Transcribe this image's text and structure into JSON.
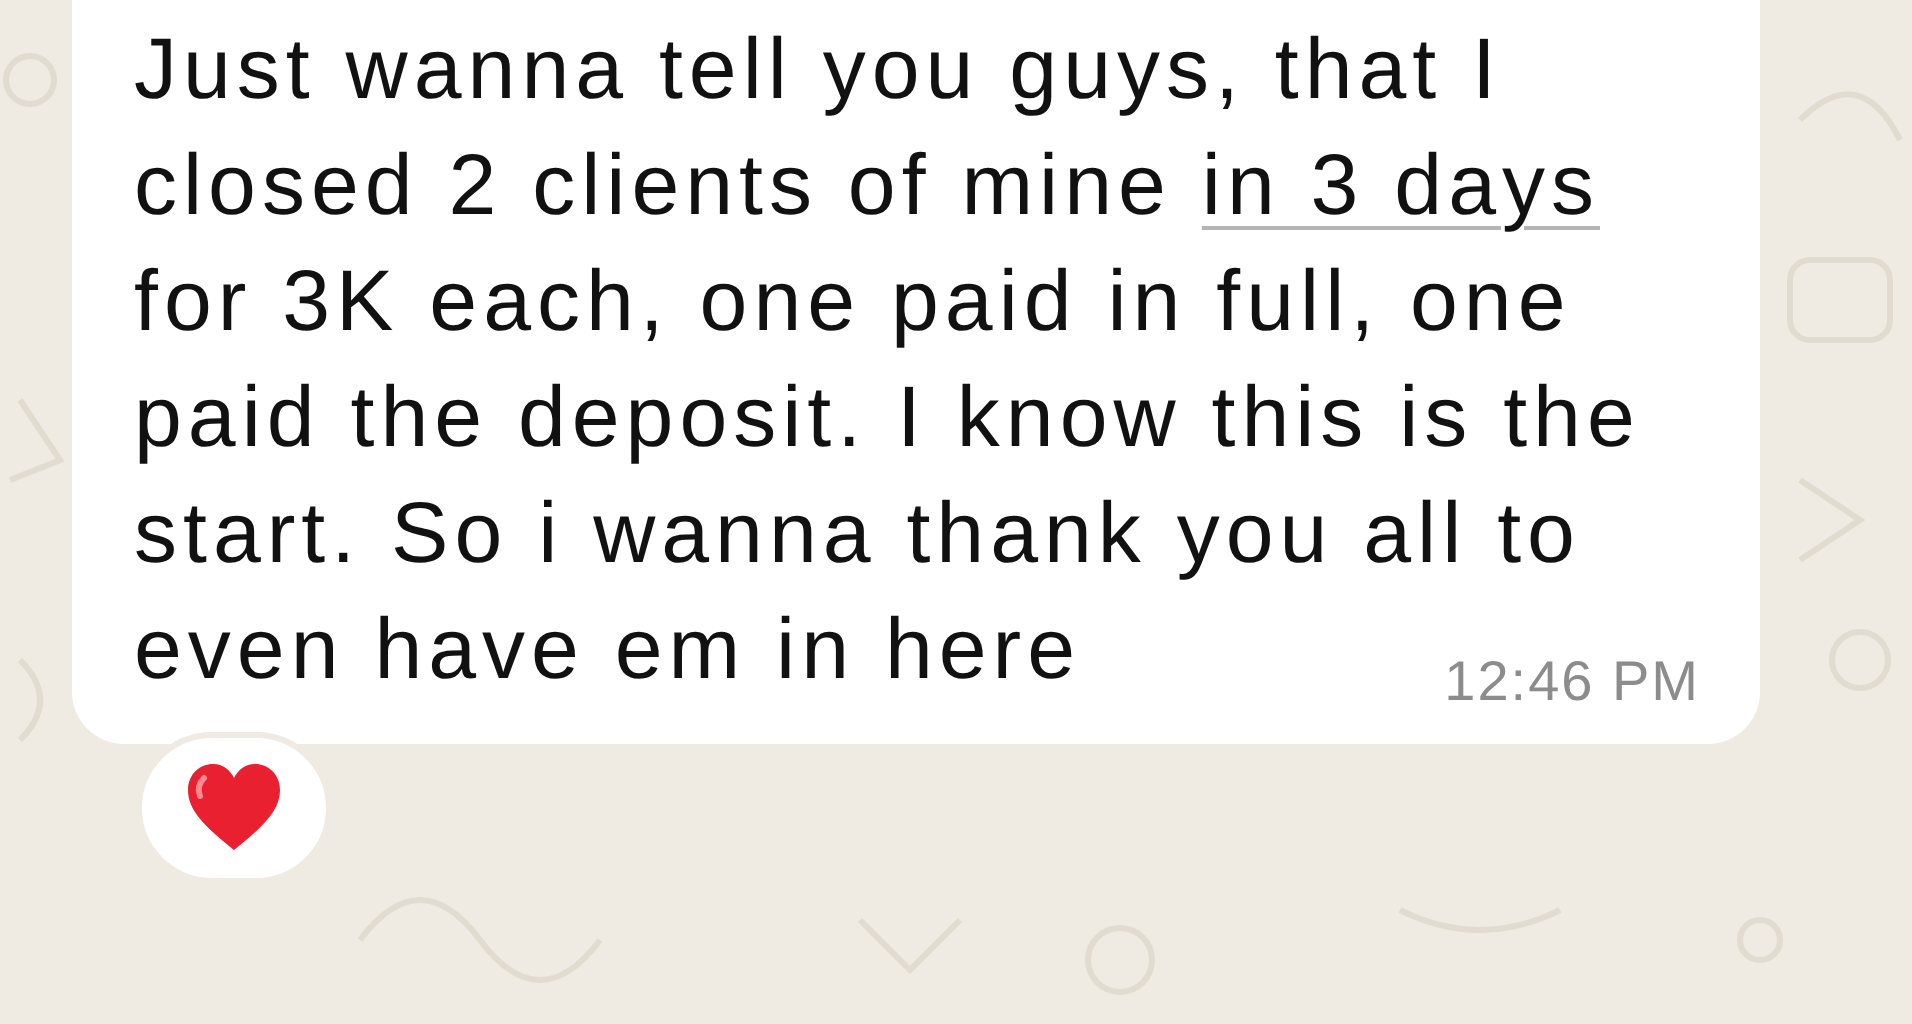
{
  "message": {
    "text_before_link": "Just wanna tell you guys, that I\nclosed 2 clients of mine ",
    "date_link": "in 3 days",
    "text_after_link": "\nfor 3K each, one paid in full, one\npaid the deposit. I know this is the\nstart. So i wanna thank you all to",
    "last_line": "even have em in here",
    "time": "12:46 PM"
  },
  "reaction": {
    "kind": "heart"
  }
}
